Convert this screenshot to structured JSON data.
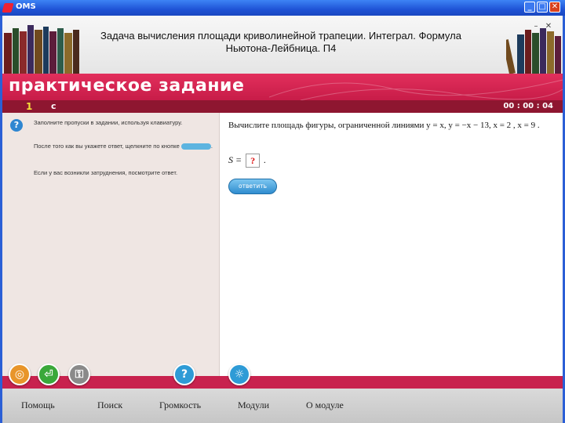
{
  "window": {
    "title": "OMS"
  },
  "header": {
    "title_line1": "Задача вычисления площади криволинейной трапеции. Интеграл. Формула",
    "title_line2": "Ньютона-Лейбница. П4"
  },
  "banner": {
    "title": "практическое задание"
  },
  "task_bar": {
    "number": "1",
    "label": "c",
    "timer": "00 : 00 : 04"
  },
  "left_panel": {
    "paragraphs": [
      "Заполните пропуски в задании, используя клавиатуру.",
      "После того как вы укажете ответ, щелкните по кнопке",
      "Если у вас возникли затруднения, посмотрите ответ."
    ]
  },
  "task": {
    "text": "Вычислите площадь фигуры, ограниченной линиями y = x, y = −x − 13, x = 2 , x = 9 .",
    "answer_prefix": "S =",
    "answer_placeholder": "?",
    "answer_suffix": ".",
    "answer_button": "ответить"
  },
  "bottom_buttons": [
    {
      "name": "lifebuoy-icon",
      "glyph": "◎",
      "color": "#e8952a"
    },
    {
      "name": "step-icon",
      "glyph": "⏎",
      "color": "#3aa83a"
    },
    {
      "name": "key-icon",
      "glyph": "⚿",
      "color": "#8a8a8a"
    },
    {
      "name": "help-icon",
      "glyph": "?",
      "color": "#2e9bd6"
    },
    {
      "name": "hint-icon",
      "glyph": "☼",
      "color": "#2e9bd6"
    }
  ],
  "menu": {
    "items": [
      "Помощь",
      "Поиск",
      "Громкость",
      "Модули",
      "О модуле"
    ]
  },
  "colors": {
    "banner": "#d42452",
    "task_bar": "#8e1630",
    "left_panel": "#efe6e3",
    "accent_button": "#2f8ccf"
  }
}
